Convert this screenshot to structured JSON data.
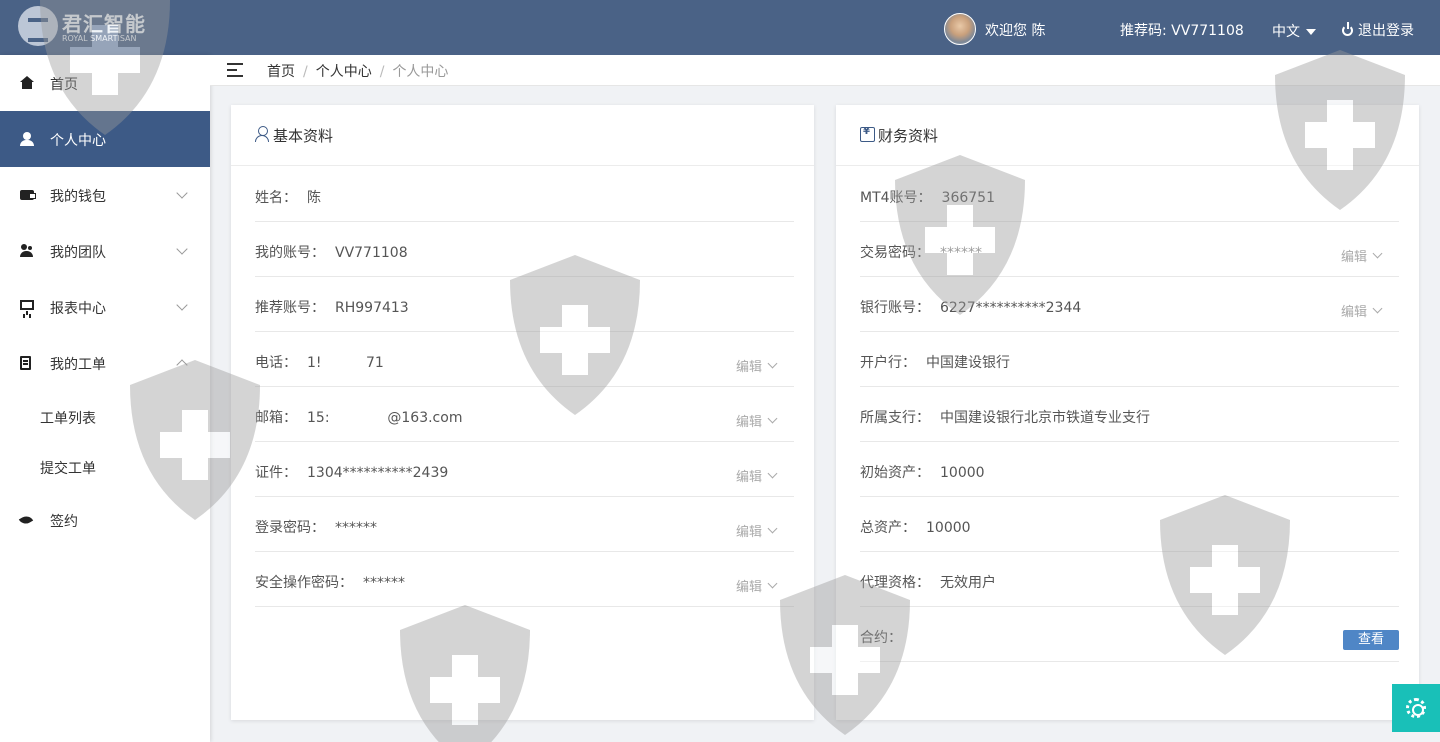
{
  "header": {
    "logo_cn": "君汇智能",
    "logo_en": "ROYAL SMARTISAN",
    "welcome": "欢迎您 陈",
    "referral": "推荐码: VV771108",
    "language": "中文",
    "logout": "退出登录"
  },
  "sidebar": {
    "items": [
      {
        "label": "首页",
        "icon": "home-icon"
      },
      {
        "label": "个人中心",
        "icon": "user-icon",
        "active": true
      },
      {
        "label": "我的钱包",
        "icon": "wallet-icon"
      },
      {
        "label": "我的团队",
        "icon": "team-icon"
      },
      {
        "label": "报表中心",
        "icon": "report-icon"
      },
      {
        "label": "我的工单",
        "icon": "ticket-icon",
        "expanded": true
      }
    ],
    "sub_items": [
      "工单列表",
      "提交工单"
    ],
    "sign": {
      "label": "签约",
      "icon": "leaf-icon"
    }
  },
  "breadcrumb": {
    "items": [
      "首页",
      "个人中心",
      "个人中心"
    ],
    "separator": "/"
  },
  "basic_info": {
    "title": "基本资料",
    "rows": [
      {
        "label": "姓名：",
        "value": "陈",
        "editable": false
      },
      {
        "label": "我的账号：",
        "value": "VV771108",
        "editable": false
      },
      {
        "label": "推荐账号：",
        "value": "RH997413",
        "editable": false
      },
      {
        "label": "电话：",
        "value": "1!          71",
        "editable": true
      },
      {
        "label": "邮箱：",
        "value": "15:             @163.com",
        "editable": true
      },
      {
        "label": "证件：",
        "value": "1304**********2439",
        "editable": true
      },
      {
        "label": "登录密码：",
        "value": "******",
        "editable": true
      },
      {
        "label": "安全操作密码：",
        "value": "******",
        "editable": true
      }
    ],
    "edit_label": "编辑"
  },
  "finance_info": {
    "title": "财务资料",
    "rows": [
      {
        "label": "MT4账号：",
        "value": "366751",
        "editable": false
      },
      {
        "label": "交易密码：",
        "value": "******",
        "editable": true
      },
      {
        "label": "银行账号：",
        "value": "6227**********2344",
        "editable": true
      },
      {
        "label": "开户行：",
        "value": "中国建设银行",
        "editable": false
      },
      {
        "label": "所属支行：",
        "value": "中国建设银行北京市铁道专业支行",
        "editable": false
      },
      {
        "label": "初始资产：",
        "value": "10000",
        "editable": false
      },
      {
        "label": "总资产：",
        "value": "10000",
        "editable": false
      },
      {
        "label": "代理资格：",
        "value": "无效用户",
        "editable": false
      },
      {
        "label": "合约：",
        "value": "",
        "editable": false
      }
    ],
    "edit_label": "编辑",
    "view_button": "查看"
  },
  "colors": {
    "topbar": "#4a6286",
    "active_nav": "#3d5a86",
    "settings_button": "#19c0b8",
    "view_button": "#4f86c6"
  }
}
